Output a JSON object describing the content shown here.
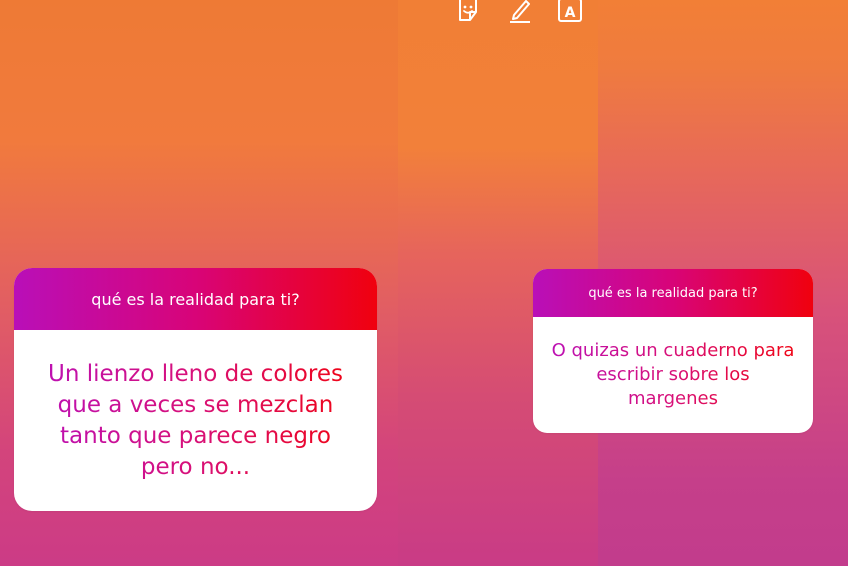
{
  "toolbar": {
    "tools": [
      {
        "icon": "sticker-icon"
      },
      {
        "icon": "pen-icon"
      },
      {
        "icon": "text-icon",
        "glyph": "A"
      }
    ]
  },
  "cards": [
    {
      "question": "qué es la realidad para ti?",
      "answer": "Un lienzo lleno de colores que a veces se mezclan tanto que parece negro pero no..."
    },
    {
      "question": "qué es la realidad para ti?",
      "answer": "O quizas un cuaderno para escribir sobre los margenes"
    }
  ],
  "colors": {
    "header_gradient": [
      "#b90fb8",
      "#d80478",
      "#f0010e"
    ],
    "background_top": "#f17f35",
    "background_bottom": "#c93b86"
  }
}
